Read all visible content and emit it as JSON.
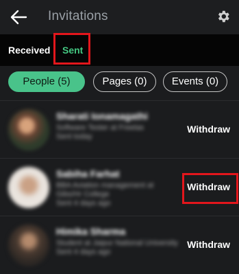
{
  "header": {
    "title": "Invitations",
    "back_icon": "arrow-left-icon",
    "settings_icon": "gear-icon"
  },
  "tabs": [
    {
      "label": "Received",
      "active": false
    },
    {
      "label": "Sent",
      "active": true
    }
  ],
  "filters": [
    {
      "label": "People (5)",
      "selected": true
    },
    {
      "label": "Pages (0)",
      "selected": false
    },
    {
      "label": "Events (0)",
      "selected": false
    }
  ],
  "invitations": [
    {
      "name": "Sharati Ionamagathi",
      "subtitle": "Software Tester at Freelas",
      "meta": "Sent today",
      "action": "Withdraw"
    },
    {
      "name": "Sabiha Farhat",
      "subtitle": "BBA Aviation management at Gibs/Hr College",
      "meta": "Sent 4 days ago",
      "action": "Withdraw"
    },
    {
      "name": "Himika Sharma",
      "subtitle": "Student at Jaipur National University",
      "meta": "Sent 4 days ago",
      "action": "Withdraw"
    }
  ],
  "colors": {
    "accent": "#49c38a",
    "sent_tab": "#44c882",
    "highlight": "#e3161c",
    "background": "#1b1c1e"
  }
}
